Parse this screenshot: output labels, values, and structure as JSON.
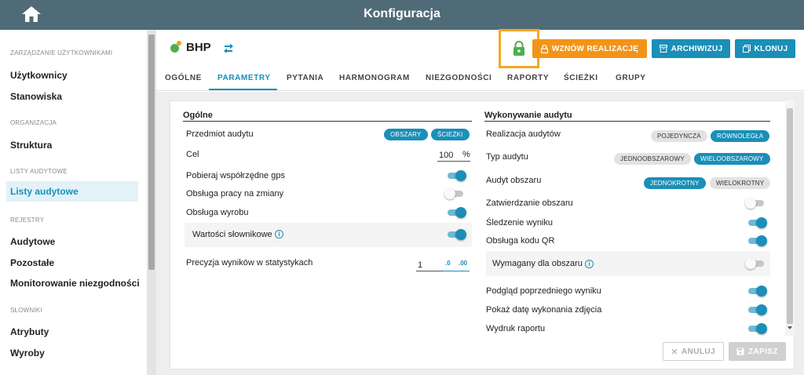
{
  "header": {
    "title": "Konfiguracja"
  },
  "sidebar": {
    "sections": [
      {
        "title": "ZARZĄDZANIE UŻYTKOWNIKAMI",
        "items": [
          "Użytkownicy",
          "Stanowiska"
        ]
      },
      {
        "title": "ORGANIZACJA",
        "items": [
          "Struktura"
        ]
      },
      {
        "title": "LISTY AUDYTOWE",
        "items": [
          "Listy audytowe"
        ]
      },
      {
        "title": "REJESTRY",
        "items": [
          "Audytowe",
          "Pozostałe",
          "Monitorowanie niezgodności"
        ]
      },
      {
        "title": "SŁOWNIKI",
        "items": [
          "Atrybuty",
          "Wyroby"
        ]
      }
    ],
    "active_item": "Listy audytowe"
  },
  "entity": {
    "name": "BHP"
  },
  "toolbar": {
    "resume": "WZNÓW REALIZACJĘ",
    "archive": "ARCHIWIZUJ",
    "clone": "KLONUJ"
  },
  "tabs": [
    "OGÓLNE",
    "PARAMETRY",
    "PYTANIA",
    "HARMONOGRAM",
    "NIEZGODNOŚCI",
    "RAPORTY",
    "ŚCIEŻKI",
    "GRUPY"
  ],
  "active_tab": "PARAMETRY",
  "left": {
    "title": "Ogólne",
    "subject": {
      "label": "Przedmiot audytu",
      "options": [
        "OBSZARY",
        "ŚCIEŻKI"
      ]
    },
    "goal": {
      "label": "Cel",
      "value": "100",
      "unit": "%"
    },
    "toggles": [
      {
        "label": "Pobieraj współrzędne gps",
        "on": true
      },
      {
        "label": "Obsługa pracy na zmiany",
        "on": false
      },
      {
        "label": "Obsługa wyrobu",
        "on": true
      }
    ],
    "dict": {
      "label": "Wartości słownikowe",
      "on": true
    },
    "precision": {
      "label": "Precyzja wyników w statystykach",
      "value": "1",
      "dec_less": ".0",
      "dec_more": ".00"
    }
  },
  "right": {
    "title": "Wykonywanie audytu",
    "realization": {
      "label": "Realizacja audytów",
      "options": [
        "POJEDYNCZA",
        "RÓWNOLEGŁA"
      ],
      "selected": "RÓWNOLEGŁA"
    },
    "type": {
      "label": "Typ audytu",
      "options": [
        "JEDNOOBSZAROWY",
        "WIELOOBSZAROWY"
      ],
      "selected": "WIELOOBSZAROWY"
    },
    "area_audit": {
      "label": "Audyt obszaru",
      "options": [
        "JEDNOKROTNY",
        "WIELOKROTNY"
      ],
      "selected": "JEDNOKROTNY"
    },
    "toggles_a": [
      {
        "label": "Zatwierdzanie obszaru",
        "on": false
      },
      {
        "label": "Śledzenie wyniku",
        "on": true
      },
      {
        "label": "Obsługa kodu QR",
        "on": true
      }
    ],
    "required": {
      "label": "Wymagany dla obszaru",
      "on": false
    },
    "toggles_b": [
      {
        "label": "Podgląd poprzedniego wyniku",
        "on": true
      },
      {
        "label": "Pokaż datę wykonania zdjęcia",
        "on": true
      },
      {
        "label": "Wydruk raportu",
        "on": true
      }
    ]
  },
  "actions": {
    "cancel": "ANULUJ",
    "save": "ZAPISZ"
  },
  "colors": {
    "topbar": "#4f6b78",
    "accent": "#1a8fb8",
    "orange": "#f39419",
    "lock": "#4caf50",
    "highlight": "#f5a623"
  }
}
